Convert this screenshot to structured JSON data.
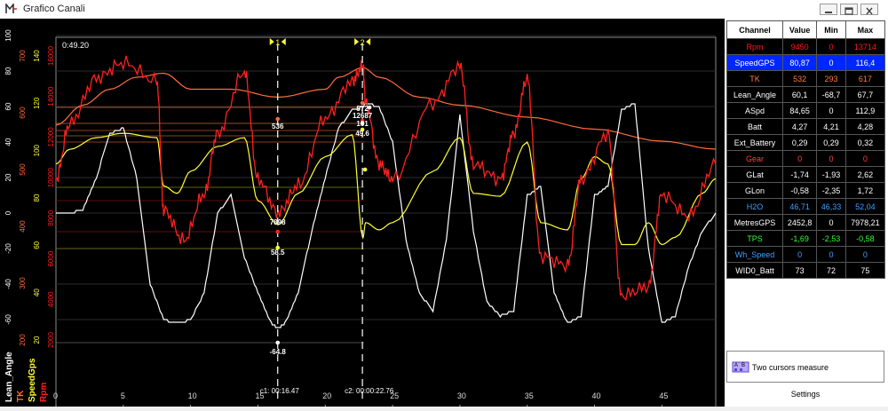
{
  "window": {
    "title": "Grafico Canali"
  },
  "chart": {
    "time_label": "0:49.20",
    "cursors": [
      {
        "label": "1",
        "readout": "c1: 00:16.47",
        "value_labels": [
          "536",
          "7898",
          "58.5",
          "-64.8"
        ]
      },
      {
        "label": "2",
        "readout": "c2: 00:00:22.76",
        "value_labels": [
          "572",
          "12687",
          "49.6",
          "101"
        ]
      }
    ],
    "axis_names": [
      "Lean_Angle",
      "TK",
      "SpeedGps",
      "Rpm"
    ],
    "axis_colors": [
      "#ffffff",
      "#ff6a3d",
      "#ffff33",
      "#ff2020"
    ]
  },
  "chart_data": {
    "type": "line",
    "xlabel": "",
    "xlim": [
      0,
      49
    ],
    "x_ticks": [
      "0",
      "5",
      "10",
      "15",
      "20",
      "25",
      "30",
      "35",
      "40",
      "45"
    ],
    "y_axes": [
      {
        "name": "Lean_Angle",
        "color": "#ffffff",
        "ticks": [
          "100",
          "80",
          "60",
          "40",
          "20",
          "0",
          "-20",
          "-40",
          "-60"
        ]
      },
      {
        "name": "TK",
        "color": "#ff6a3d",
        "ticks": [
          "700",
          "600",
          "500",
          "400",
          "300",
          "200"
        ]
      },
      {
        "name": "SpeedGps",
        "color": "#ffff33",
        "ticks": [
          "140",
          "120",
          "100",
          "80",
          "60",
          "40",
          "20"
        ]
      },
      {
        "name": "Rpm",
        "color": "#ff2020",
        "ticks": [
          "16000",
          "14000",
          "12000",
          "10000",
          "8000",
          "6000",
          "4000",
          "2000"
        ]
      }
    ],
    "series": [
      {
        "name": "TK",
        "color": "#ff6a3d",
        "x": [
          0,
          2,
          4,
          6,
          8,
          10,
          13,
          16.5,
          20,
          21,
          22.8,
          24,
          27,
          30,
          35,
          40,
          45,
          49
        ],
        "values": [
          500,
          525,
          545,
          560,
          565,
          545,
          545,
          535,
          545,
          560,
          572,
          560,
          535,
          525,
          510,
          495,
          480,
          470
        ]
      },
      {
        "name": "Rpm",
        "color": "#ff2020",
        "x": [
          0,
          1,
          3,
          5,
          7.5,
          8,
          9.5,
          11,
          12,
          14,
          15,
          16.5,
          18,
          20,
          22,
          22.8,
          23,
          24,
          25,
          28,
          30,
          31,
          33,
          34,
          35,
          36,
          38,
          39,
          41,
          42,
          44,
          45,
          47,
          49
        ],
        "values": [
          9000,
          10800,
          12300,
          12800,
          12200,
          8000,
          7000,
          8500,
          10500,
          12500,
          9000,
          7898,
          8800,
          11000,
          12200,
          12687,
          11500,
          9500,
          9000,
          11500,
          12700,
          9500,
          9000,
          10500,
          12300,
          6500,
          6200,
          9000,
          10500,
          5200,
          5500,
          8500,
          7800,
          9500
        ]
      },
      {
        "name": "SpeedGps",
        "color": "#ffff33",
        "x": [
          0,
          1,
          3,
          5,
          7.5,
          8,
          9,
          10,
          12,
          14,
          15,
          16.5,
          18,
          20,
          22,
          22.8,
          23,
          24,
          25,
          28,
          30,
          31,
          33,
          35,
          36,
          38,
          39,
          40,
          41,
          42,
          43,
          44,
          45,
          46,
          48,
          49
        ],
        "values": [
          100,
          110,
          118,
          121,
          118,
          85,
          80,
          95,
          112,
          118,
          75,
          58.5,
          80,
          105,
          120,
          49.6,
          60,
          55,
          60,
          95,
          118,
          80,
          78,
          115,
          60,
          55,
          90,
          105,
          100,
          45,
          45,
          60,
          45,
          50,
          80,
          90
        ]
      },
      {
        "name": "Lean_Angle",
        "color": "#ffffff",
        "x": [
          0,
          1,
          2,
          3,
          4,
          5,
          6,
          7,
          8,
          9,
          10,
          11,
          12,
          13,
          14,
          15,
          16,
          16.5,
          17,
          18,
          19,
          20,
          21,
          22,
          22.8,
          23,
          24,
          25,
          26,
          27,
          28,
          29,
          30,
          31,
          32,
          33,
          34,
          35,
          36,
          37,
          38,
          39,
          40,
          41,
          42,
          43,
          44,
          45,
          46,
          47,
          48,
          49
        ],
        "values": [
          0,
          0,
          2,
          20,
          45,
          48,
          20,
          -40,
          -60,
          -62,
          -60,
          -45,
          0,
          10,
          -25,
          -45,
          -62,
          -64.8,
          -62,
          -45,
          -10,
          20,
          48,
          58,
          60,
          62,
          60,
          40,
          -15,
          -45,
          -55,
          -15,
          55,
          -10,
          -50,
          -58,
          -55,
          10,
          15,
          -45,
          -62,
          -58,
          10,
          15,
          58,
          62,
          -20,
          -62,
          -58,
          -30,
          -10,
          0
        ]
      }
    ]
  },
  "panel": {
    "headers": [
      "Channel",
      "Value",
      "Min",
      "Max"
    ],
    "rows": [
      {
        "channel": "Rpm",
        "value": "9450",
        "min": "0",
        "max": "13714",
        "color": "#ff1a1a",
        "bg": "#000000"
      },
      {
        "channel": "SpeedGPS",
        "value": "80,87",
        "min": "0",
        "max": "116,4",
        "color": "#ffffff",
        "bg": "#0026ff"
      },
      {
        "channel": "TK",
        "value": "532",
        "min": "293",
        "max": "617",
        "color": "#ff7a3d",
        "bg": "#000000"
      },
      {
        "channel": "Lean_Angle",
        "value": "60,1",
        "min": "-68,7",
        "max": "67,7",
        "color": "#ffffff",
        "bg": "#000000"
      },
      {
        "channel": "ASpd",
        "value": "84,65",
        "min": "0",
        "max": "112,9",
        "color": "#ffffff",
        "bg": "#000000"
      },
      {
        "channel": "Batt",
        "value": "4,27",
        "min": "4,21",
        "max": "4,28",
        "color": "#ffffff",
        "bg": "#000000"
      },
      {
        "channel": "Ext_Battery",
        "value": "0,29",
        "min": "0,29",
        "max": "0,32",
        "color": "#ffffff",
        "bg": "#000000"
      },
      {
        "channel": "Gear",
        "value": "0",
        "min": "0",
        "max": "0",
        "color": "#ff4040",
        "bg": "#000000"
      },
      {
        "channel": "GLat",
        "value": "-1,74",
        "min": "-1,93",
        "max": "2,62",
        "color": "#ffffff",
        "bg": "#000000"
      },
      {
        "channel": "GLon",
        "value": "-0,58",
        "min": "-2,35",
        "max": "1,72",
        "color": "#ffffff",
        "bg": "#000000"
      },
      {
        "channel": "H2O",
        "value": "46,71",
        "min": "46,33",
        "max": "52,04",
        "color": "#3fa0ff",
        "bg": "#000000"
      },
      {
        "channel": "MetresGPS",
        "value": "2452,8",
        "min": "0",
        "max": "7978,21",
        "color": "#ffffff",
        "bg": "#000000"
      },
      {
        "channel": "TPS",
        "value": "-1,69",
        "min": "-2,53",
        "max": "-0,58",
        "color": "#33ff33",
        "bg": "#000000"
      },
      {
        "channel": "Wh_Speed",
        "value": "0",
        "min": "0",
        "max": "0",
        "color": "#3fa0ff",
        "bg": "#000000"
      },
      {
        "channel": "WID0_Batt",
        "value": "73",
        "min": "72",
        "max": "75",
        "color": "#ffffff",
        "bg": "#000000"
      }
    ],
    "tool_label": "Two cursors measure",
    "settings_label": "Settings"
  }
}
